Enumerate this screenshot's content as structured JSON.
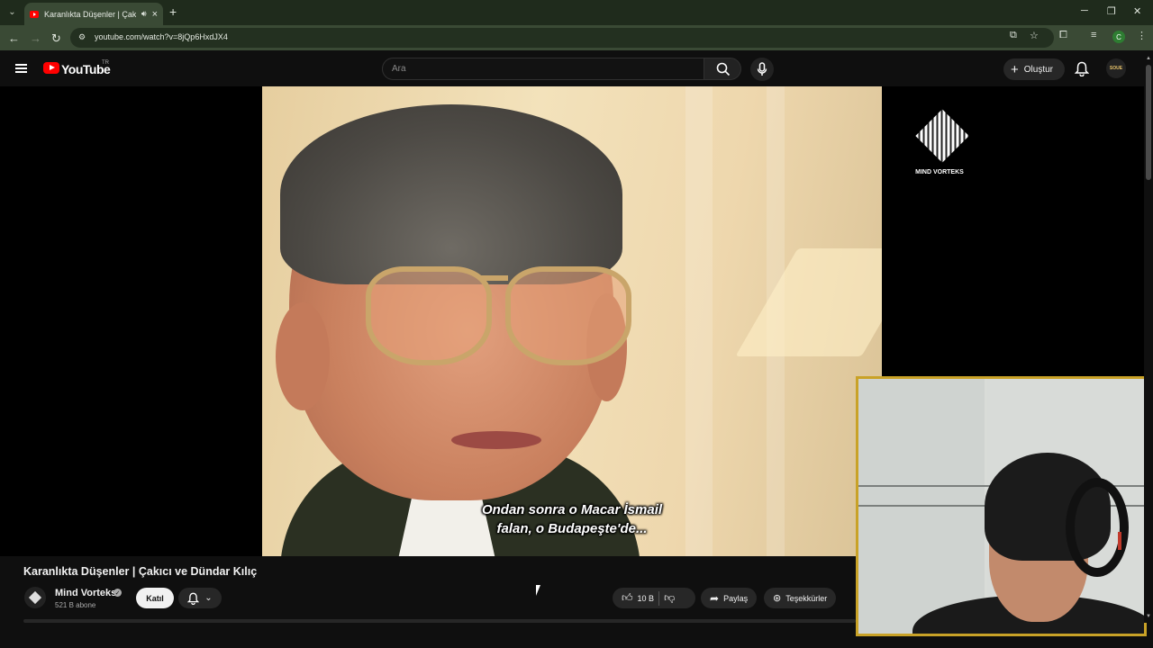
{
  "browser": {
    "tab_title": "Karanlıkta Düşenler | Çakıcı",
    "new_tab": "+",
    "url": "youtube.com/watch?v=8jQp6HxdJX4",
    "profile_initial": "C",
    "window_controls": [
      "minimize-icon",
      "restore-icon",
      "close-icon"
    ]
  },
  "header": {
    "logo_text": "YouTube",
    "country_code": "TR",
    "search_placeholder": "Ara",
    "create_label": "Oluştur",
    "avatar_text": "SOUE"
  },
  "player": {
    "subtitle_line1": "Ondan sonra o Macar İsmail",
    "subtitle_line2": "falan, o Budapeşte'de...",
    "watermark": "MIND VORTEKS"
  },
  "video": {
    "title": "Karanlıkta Düşenler | Çakıcı ve Dündar Kılıç",
    "channel_name": "Mind Vorteks",
    "subscribers": "521 B abone",
    "join_label": "Katıl",
    "likes": "10 B",
    "share_label": "Paylaş",
    "thanks_label": "Teşekkürler"
  },
  "colors": {
    "browser_frame": "#1f2b1c",
    "browser_toolbar": "#3a4a35",
    "yt_background": "#0f0f0f",
    "yt_red": "#ff0000",
    "webcam_border": "#c9a227"
  }
}
